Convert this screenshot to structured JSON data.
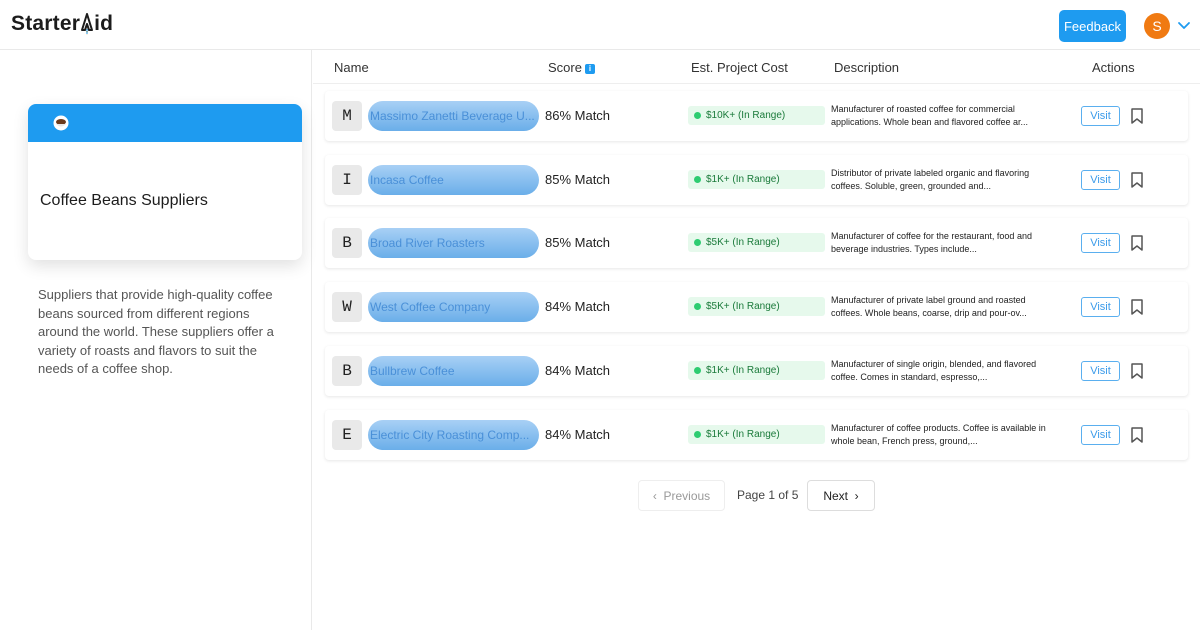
{
  "header": {
    "logo_part1": "Starter",
    "logo_part2": "id",
    "feedback_label": "Feedback",
    "avatar_initial": "S"
  },
  "category": {
    "title": "Coffee Beans Suppliers",
    "description": "Suppliers that provide high-quality coffee beans sourced from different regions around the world. These suppliers offer a variety of roasts and flavors to suit the needs of a coffee shop.",
    "accent_color": "#1e9bf0"
  },
  "table": {
    "columns": {
      "name": "Name",
      "score": "Score",
      "cost": "Est. Project Cost",
      "description": "Description",
      "actions": "Actions"
    },
    "rows": [
      {
        "letter": "M",
        "name": "Massimo Zanetti Beverage U...",
        "score": "86% Match",
        "cost": "$10K+  (In Range)",
        "description": "Manufacturer of roasted coffee for commercial applications. Whole bean and flavored coffee ar...",
        "visit": "Visit"
      },
      {
        "letter": "I",
        "name": "Incasa Coffee",
        "score": "85% Match",
        "cost": "$1K+  (In Range)",
        "description": "Distributor of private labeled organic and flavoring coffees. Soluble, green, grounded and...",
        "visit": "Visit"
      },
      {
        "letter": "B",
        "name": "Broad River Roasters",
        "score": "85% Match",
        "cost": "$5K+  (In Range)",
        "description": "Manufacturer of coffee for the restaurant, food and beverage industries. Types include...",
        "visit": "Visit"
      },
      {
        "letter": "W",
        "name": "West Coffee Company",
        "score": "84% Match",
        "cost": "$5K+  (In Range)",
        "description": "Manufacturer of private label ground and roasted coffees. Whole beans, coarse, drip and pour-ov...",
        "visit": "Visit"
      },
      {
        "letter": "B",
        "name": "Bullbrew Coffee",
        "score": "84% Match",
        "cost": "$1K+  (In Range)",
        "description": "Manufacturer of single origin, blended, and flavored coffee. Comes in standard, espresso,...",
        "visit": "Visit"
      },
      {
        "letter": "E",
        "name": "Electric City Roasting Comp...",
        "score": "84% Match",
        "cost": "$1K+  (In Range)",
        "description": "Manufacturer of coffee products. Coffee is available in whole bean, French press, ground,...",
        "visit": "Visit"
      }
    ]
  },
  "pagination": {
    "previous": "Previous",
    "page_info": "Page 1 of 5",
    "next": "Next"
  }
}
